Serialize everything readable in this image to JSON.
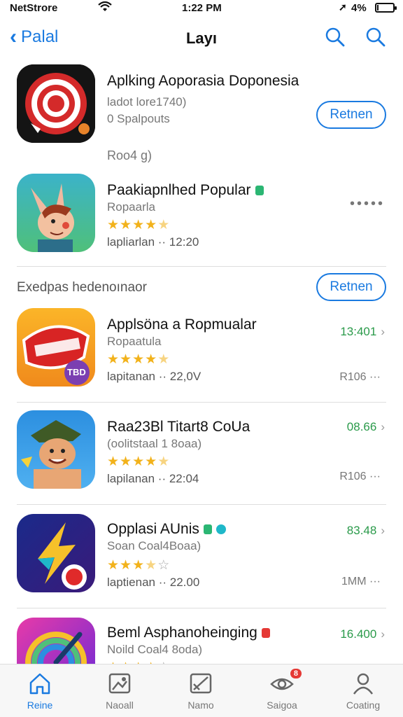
{
  "status_bar": {
    "carrier": "NetStrore",
    "time": "1:22 PM",
    "battery": "4%",
    "battery_level": 0.04
  },
  "nav": {
    "back_label": "Palal",
    "title": "Layı"
  },
  "apps_top": [
    {
      "name": "Aplking Aoporasia Doponesia",
      "sub": "ladot lore1740)",
      "meta": "0 Spalpouts",
      "extra": "Roo4 g)",
      "action": "Retnen"
    },
    {
      "name": "Paakiapnlhed Popular",
      "sub": "Ropaarla",
      "rating": 4.5,
      "meta": "lapliarlan ·· 12:20"
    }
  ],
  "section": {
    "label": "Exedpas hedenoınaor",
    "action": "Retnen"
  },
  "apps": [
    {
      "name": "Applsöna a Ropmualar",
      "sub": "Ropaatula",
      "rating": 4.5,
      "meta": "lapitanan ·· 22,0V",
      "price": "13:401",
      "right_meta": "R106 ···",
      "icon_badge": "TBD"
    },
    {
      "name": "Raa23Bl Titart8 CoUa",
      "sub": "(oolitstaal 1 8oaa)",
      "rating": 4.5,
      "meta": "lapilanan ·· 22:04",
      "price": "08.66",
      "right_meta": "R106 ···"
    },
    {
      "name": "Opplasi AUnis",
      "sub": "Soan Coal4Boaa)",
      "rating": 3.5,
      "meta": "laptienan ·· 22.00",
      "price": "83.48",
      "right_meta": "1MM ···"
    },
    {
      "name": "Beml Asphanoheinging",
      "sub": "Noild Coal4 8oda)",
      "rating": 4.0,
      "price": "16.400"
    }
  ],
  "tabs": [
    {
      "label": "Reine",
      "icon": "home-icon",
      "active": true
    },
    {
      "label": "Naoall",
      "icon": "picture-icon"
    },
    {
      "label": "Namo",
      "icon": "image-icon"
    },
    {
      "label": "Saigoa",
      "icon": "eye-icon",
      "badge": "8"
    },
    {
      "label": "Coating",
      "icon": "person-icon"
    }
  ],
  "colors": {
    "accent": "#1a7ae0",
    "price": "#2a9a4a",
    "star": "#f2b21b"
  }
}
